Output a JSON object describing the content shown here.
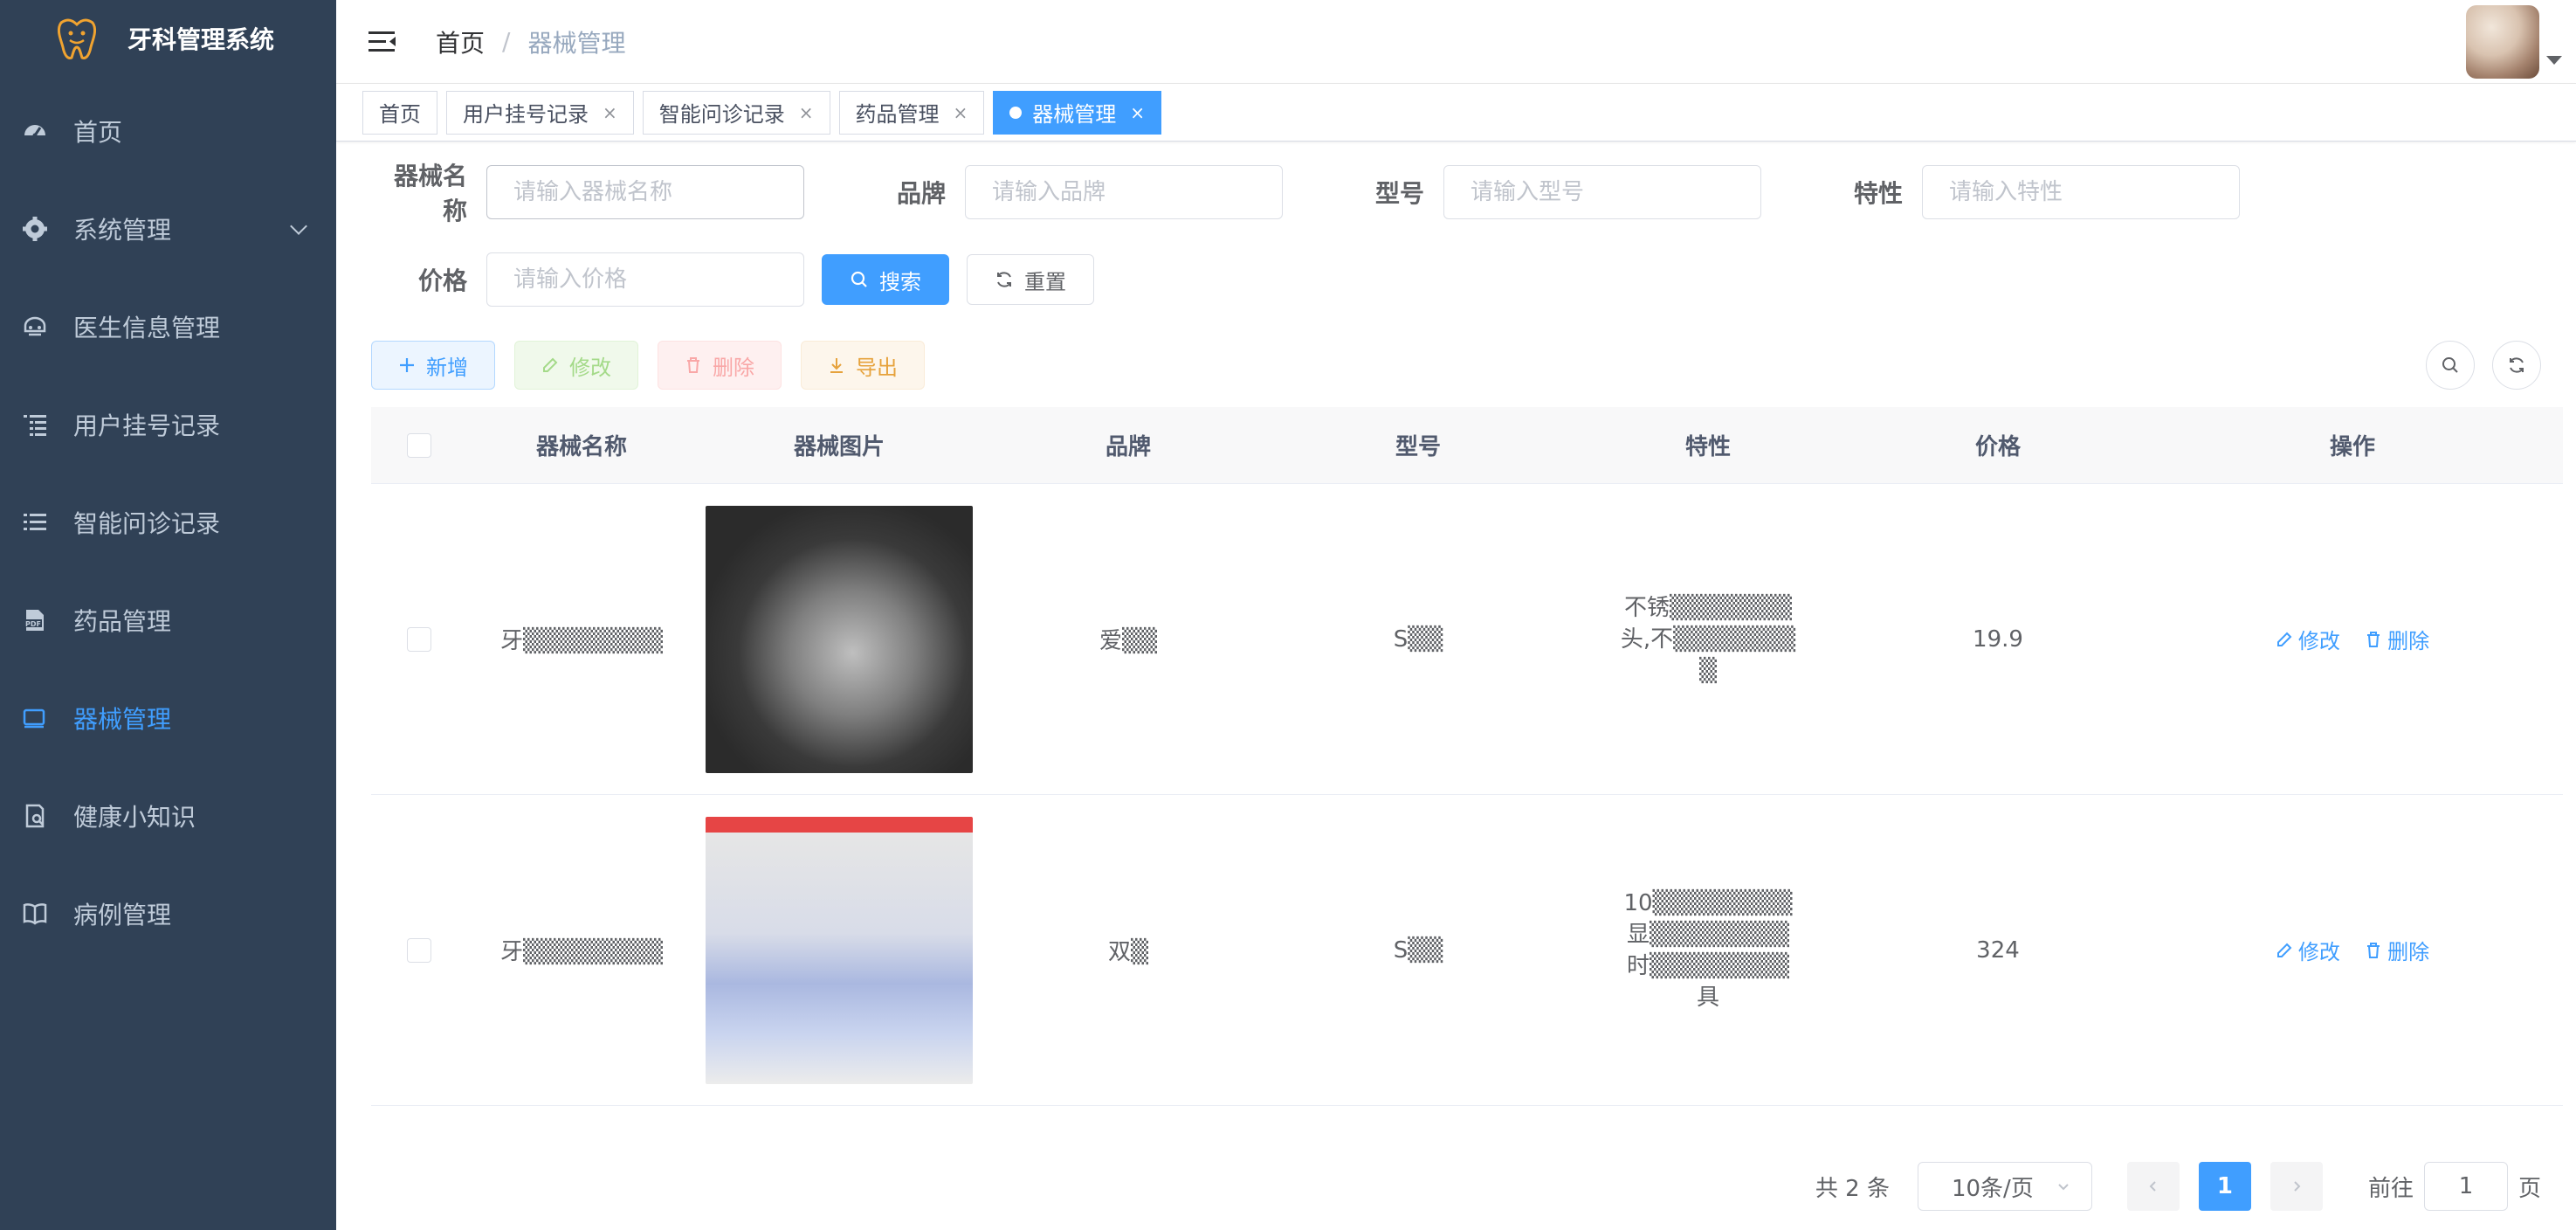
{
  "app": {
    "title": "牙科管理系统",
    "accent_color": "#409EFF",
    "sidebar_bg": "#304156"
  },
  "sidebar": {
    "items": [
      {
        "label": "首页",
        "icon": "dashboard-icon",
        "active": false
      },
      {
        "label": "系统管理",
        "icon": "gear-icon",
        "active": false,
        "expandable": true
      },
      {
        "label": "医生信息管理",
        "icon": "doctor-icon",
        "active": false
      },
      {
        "label": "用户挂号记录",
        "icon": "list-tree-icon",
        "active": false
      },
      {
        "label": "智能问诊记录",
        "icon": "list-icon",
        "active": false
      },
      {
        "label": "药品管理",
        "icon": "pdf-icon",
        "active": false
      },
      {
        "label": "器械管理",
        "icon": "monitor-icon",
        "active": true
      },
      {
        "label": "健康小知识",
        "icon": "knowledge-icon",
        "active": false
      },
      {
        "label": "病例管理",
        "icon": "book-icon",
        "active": false
      }
    ]
  },
  "header": {
    "breadcrumb": {
      "home": "首页",
      "separator": "/",
      "current": "器械管理"
    }
  },
  "tags": [
    {
      "label": "首页",
      "closable": false,
      "active": false
    },
    {
      "label": "用户挂号记录",
      "closable": true,
      "active": false
    },
    {
      "label": "智能问诊记录",
      "closable": true,
      "active": false
    },
    {
      "label": "药品管理",
      "closable": true,
      "active": false
    },
    {
      "label": "器械管理",
      "closable": true,
      "active": true
    }
  ],
  "tag_close_glyph": "×",
  "search_form": {
    "fields": [
      {
        "label": "器械名称",
        "placeholder": "请输入器械名称",
        "value": ""
      },
      {
        "label": "品牌",
        "placeholder": "请输入品牌",
        "value": ""
      },
      {
        "label": "型号",
        "placeholder": "请输入型号",
        "value": ""
      },
      {
        "label": "特性",
        "placeholder": "请输入特性",
        "value": ""
      },
      {
        "label": "价格",
        "placeholder": "请输入价格",
        "value": ""
      }
    ],
    "search_label": "搜索",
    "reset_label": "重置"
  },
  "toolbar": {
    "add_label": "新增",
    "edit_label": "修改",
    "delete_label": "删除",
    "export_label": "导出"
  },
  "table": {
    "columns": [
      "器械名称",
      "器械图片",
      "品牌",
      "型号",
      "特性",
      "价格",
      "操作"
    ],
    "rows": [
      {
        "name": "牙▒▒▒▒▒▒▒▒",
        "brand": "爱▒▒",
        "model": "S▒▒",
        "feature": [
          "不锈▒▒▒▒▒▒▒",
          "头,不▒▒▒▒▒▒▒",
          "▒"
        ],
        "price": "19.9",
        "edit": "修改",
        "delete": "删除"
      },
      {
        "name": "牙▒▒▒▒▒▒▒▒",
        "brand": "双▒",
        "model": "S▒▒",
        "feature": [
          "10▒▒▒▒▒▒▒▒",
          "显▒▒▒▒▒▒▒▒",
          "时▒▒▒▒▒▒▒▒",
          "具"
        ],
        "price": "324",
        "edit": "修改",
        "delete": "删除"
      }
    ]
  },
  "pagination": {
    "total_text": "共 2 条",
    "page_size": "10条/页",
    "current_page": "1",
    "goto_label": "前往",
    "goto_value": "1",
    "page_suffix": "页"
  }
}
